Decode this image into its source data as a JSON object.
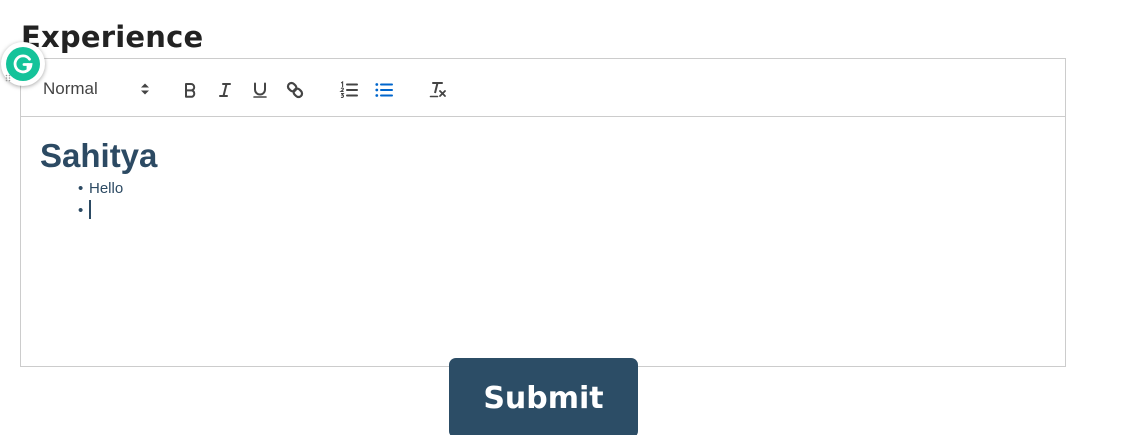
{
  "section": {
    "title": "Experience"
  },
  "toolbar": {
    "header_select": {
      "value": "Normal"
    },
    "buttons": [
      {
        "name": "bold",
        "icon": "bold-icon"
      },
      {
        "name": "italic",
        "icon": "italic-icon"
      },
      {
        "name": "underline",
        "icon": "underline-icon"
      },
      {
        "name": "link",
        "icon": "link-icon"
      },
      {
        "name": "ordered-list",
        "icon": "ordered-list-icon"
      },
      {
        "name": "bullet-list",
        "icon": "bullet-list-icon",
        "active": true
      },
      {
        "name": "clear-formatting",
        "icon": "clear-formatting-icon"
      }
    ],
    "icon_color": "#444444",
    "active_color": "#06c"
  },
  "editor": {
    "heading": "Sahitya",
    "list_items": [
      "Hello",
      ""
    ],
    "bullet": "•",
    "text_color": "#2c4a63"
  },
  "grammarly": {
    "icon": "grammarly-icon",
    "color": "#15c39a"
  },
  "submit": {
    "label": "Submit",
    "background": "#2c4d66"
  }
}
